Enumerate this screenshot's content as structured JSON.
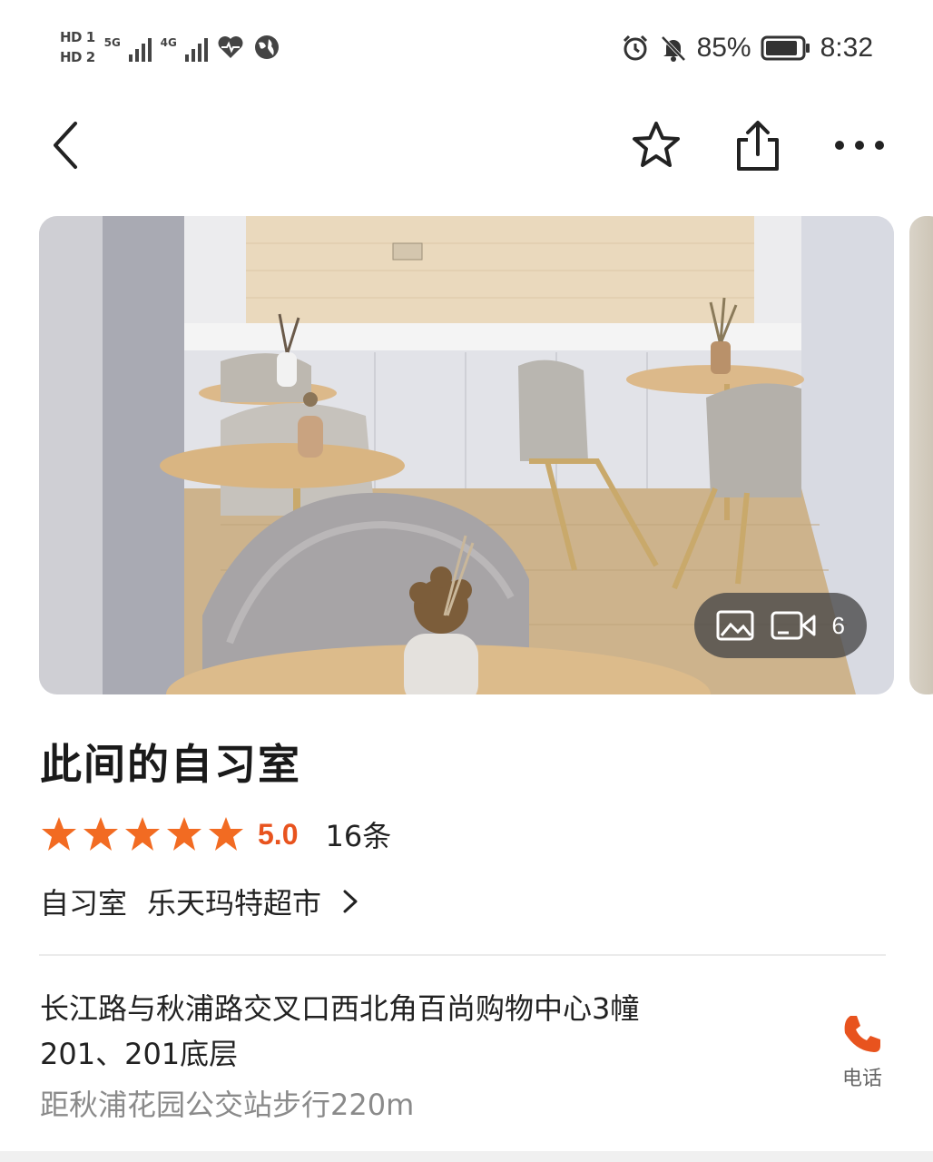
{
  "status_bar": {
    "sim1": "HD 1",
    "sim2": "HD 2",
    "net1": "5G",
    "net2": "4G",
    "battery": "85%",
    "time": "8:32"
  },
  "nav": {
    "back_icon": "chevron-left",
    "favorite_icon": "star-outline",
    "share_icon": "share",
    "more_icon": "more-dots"
  },
  "gallery": {
    "media_count": "6"
  },
  "place": {
    "name": "此间的自习室",
    "rating_stars": 5,
    "score": "5.0",
    "review_count": "16条",
    "category": "自习室",
    "location_tag": "乐天玛特超市",
    "address_line1": "长江路与秋浦路交叉口西北角百尚购物中心3幢",
    "address_line2": "201、201底层",
    "distance": "距秋浦花园公交站步行220m",
    "phone_label": "电话"
  },
  "colors": {
    "accent": "#e8531e",
    "star": "#f26b22"
  }
}
